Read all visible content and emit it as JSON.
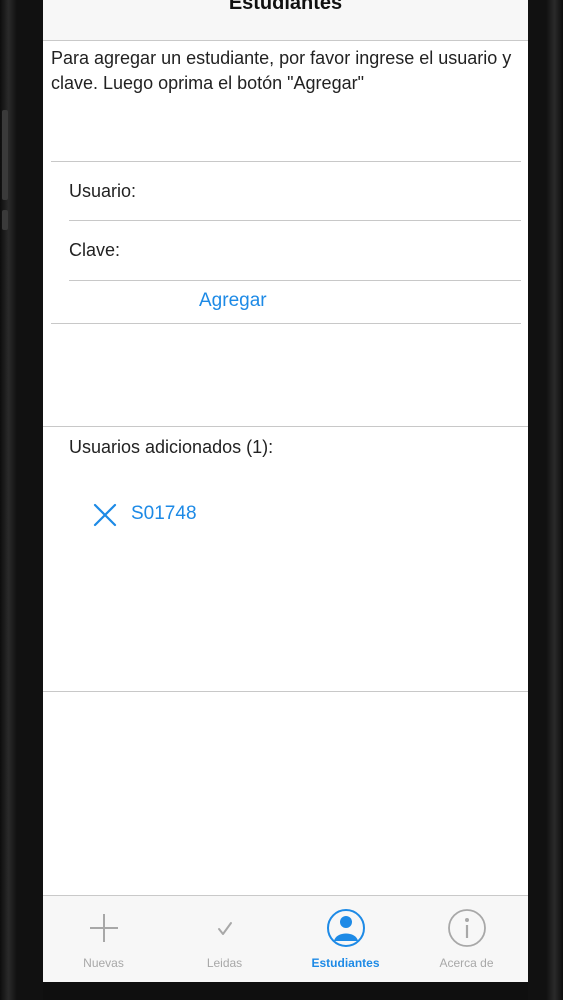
{
  "nav": {
    "title": "Estudiantes"
  },
  "instructions": "Para agregar un estudiante, por favor ingrese el usuario y clave. Luego oprima el botón \"Agregar\"",
  "form": {
    "usuario_label": "Usuario:",
    "clave_label": "Clave:",
    "add_button": "Agregar"
  },
  "added_users": {
    "header": "Usuarios adicionados (1):",
    "items": [
      {
        "id": "S01748",
        "icon": "close-icon"
      }
    ]
  },
  "tabs": [
    {
      "label": "Nuevas",
      "icon": "plus-icon",
      "active": false
    },
    {
      "label": "Leidas",
      "icon": "checkmark-icon",
      "active": false
    },
    {
      "label": "Estudiantes",
      "icon": "person-icon",
      "active": true
    },
    {
      "label": "Acerca de",
      "icon": "info-icon",
      "active": false
    }
  ],
  "colors": {
    "accent": "#1d8ae6",
    "inactive": "#a8a8a8"
  }
}
